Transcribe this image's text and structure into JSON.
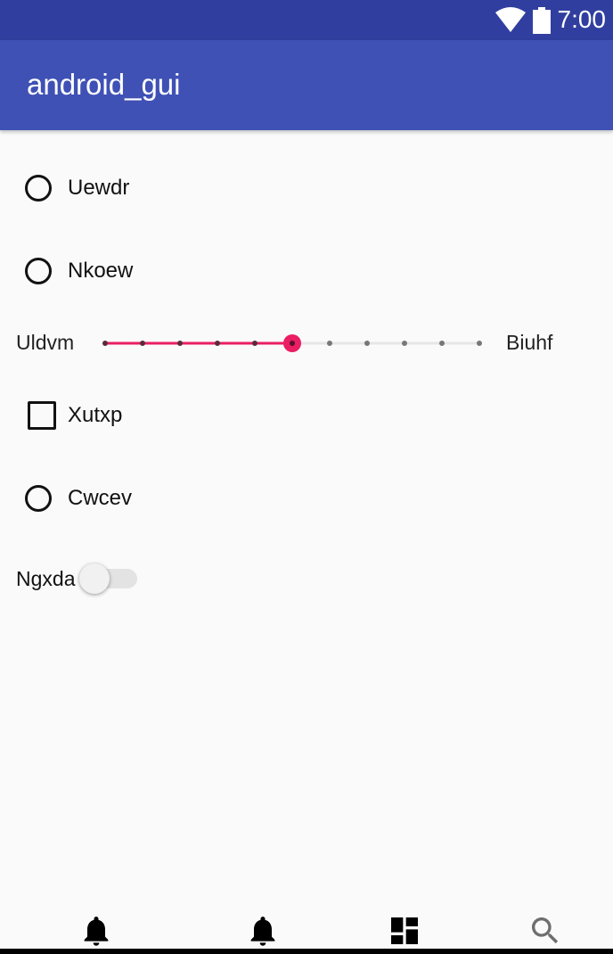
{
  "status_bar": {
    "time": "7:00",
    "icons": [
      "wifi-icon",
      "battery-icon"
    ]
  },
  "app_bar": {
    "title": "android_gui"
  },
  "options": [
    {
      "label": "Uewdr",
      "type": "radio"
    },
    {
      "label": "Nkoew",
      "type": "radio"
    },
    {
      "label": "Xutxp",
      "type": "checkbox"
    },
    {
      "label": "Cwcev",
      "type": "radio"
    }
  ],
  "slider": {
    "min_label": "Uldvm",
    "max_label": "Biuhf",
    "steps": 10,
    "value": 5,
    "accent_color": "#e91e63"
  },
  "switch": {
    "label": "Ngxda",
    "checked": false
  },
  "bottom_nav": {
    "items": [
      "bell-icon",
      "bell-icon",
      "dashboard-icon",
      "search-icon"
    ]
  }
}
